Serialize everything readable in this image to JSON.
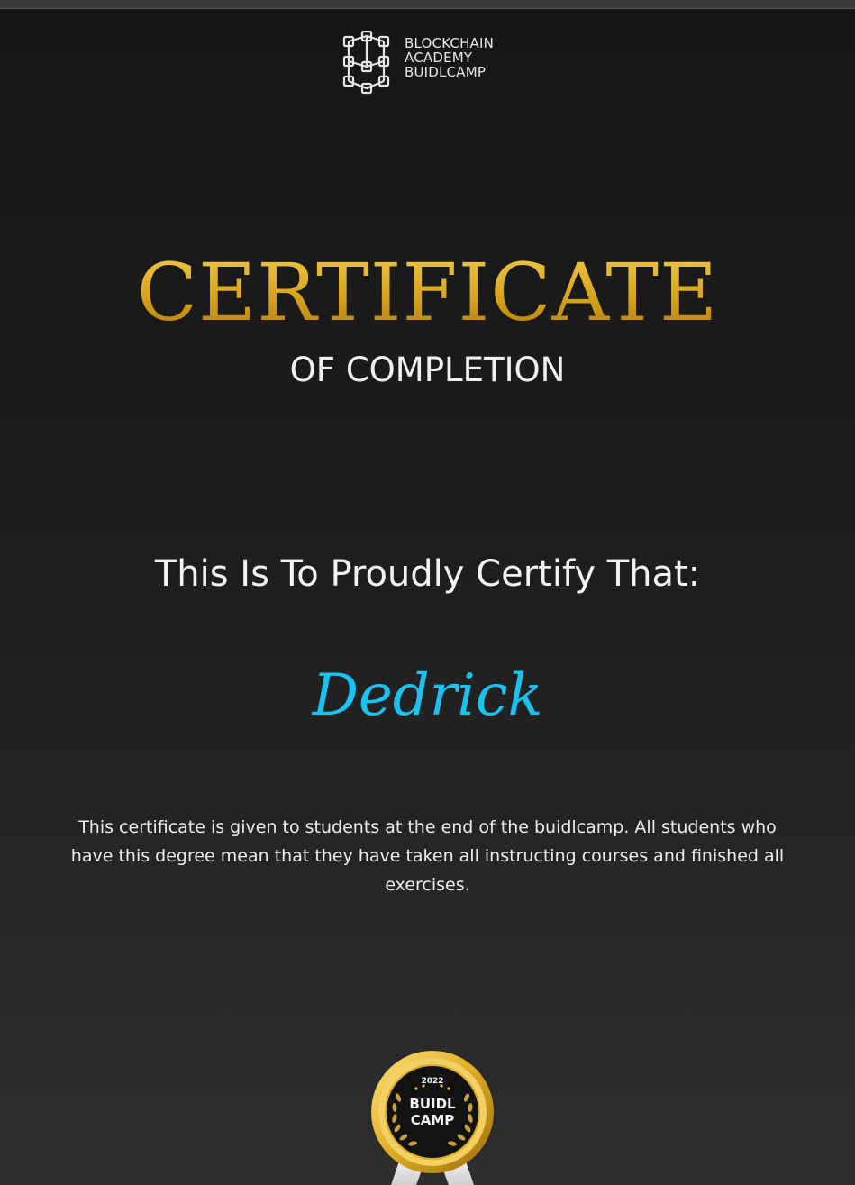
{
  "logo": {
    "icon": "blockchain-network-icon",
    "lines": [
      "BLOCKCHAIN",
      "ACADEMY",
      "BUIDLCAMP"
    ]
  },
  "certificate": {
    "title": "CERTIFICATE",
    "subtitle": "OF COMPLETION",
    "certify_text": "This Is To Proudly Certify That:",
    "recipient_name": "Dedrick",
    "description": "This certificate is given to students at the end of the  buidlcamp. All students who have this degree mean that they have taken all instructing courses and finished all exercises."
  },
  "badge": {
    "icon": "award-seal-icon",
    "year": "2022",
    "line1": "BUIDL",
    "line2": "CAMP"
  },
  "colors": {
    "background": "#1c1c1c",
    "gold": "#d7a21b",
    "name_blue": "#19c3ef",
    "text": "#f2f2f2"
  }
}
